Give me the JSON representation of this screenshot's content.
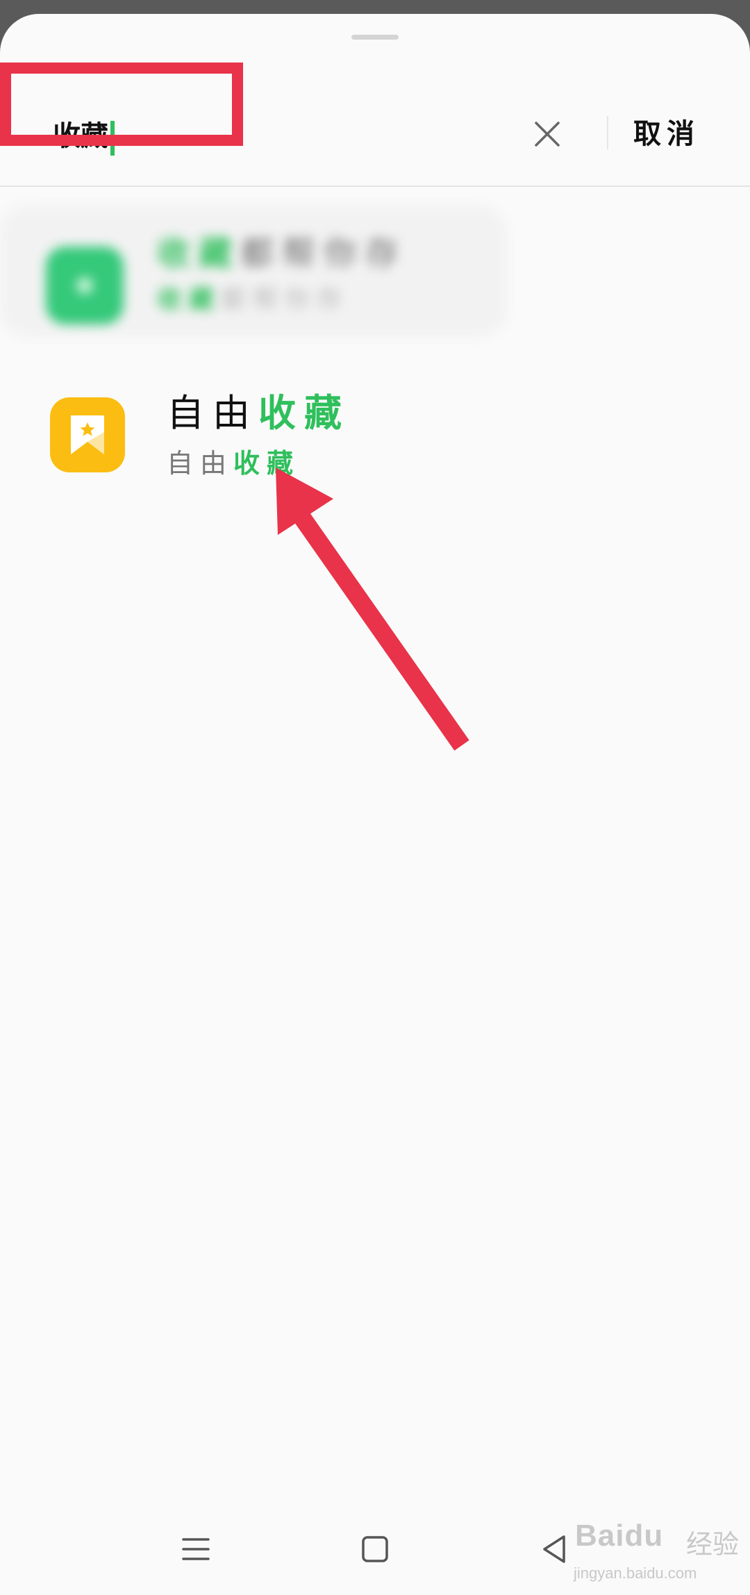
{
  "search": {
    "query": "收藏",
    "clear_icon": "close-icon",
    "cancel_label": "取消"
  },
  "blurred_result": {
    "title_highlight": "收藏",
    "title_rest": "都帮你存",
    "subtitle_highlight": "收藏",
    "subtitle_rest": "都帮你存",
    "icon": "app-icon",
    "icon_color": "#35c97a"
  },
  "result": {
    "title_prefix": "自由",
    "title_highlight": "收藏",
    "subtitle_prefix": "自由",
    "subtitle_highlight": "收藏",
    "icon": "bookmark-star-icon",
    "icon_color": "#fbbd11"
  },
  "colors": {
    "highlight": "#2fbf5c",
    "annotation": "#e8334a"
  },
  "nav": {
    "menu_icon": "menu-icon",
    "home_icon": "home-icon",
    "back_icon": "back-icon"
  },
  "watermark": {
    "logo": "Baidu",
    "label": "经验",
    "url": "jingyan.baidu.com"
  }
}
